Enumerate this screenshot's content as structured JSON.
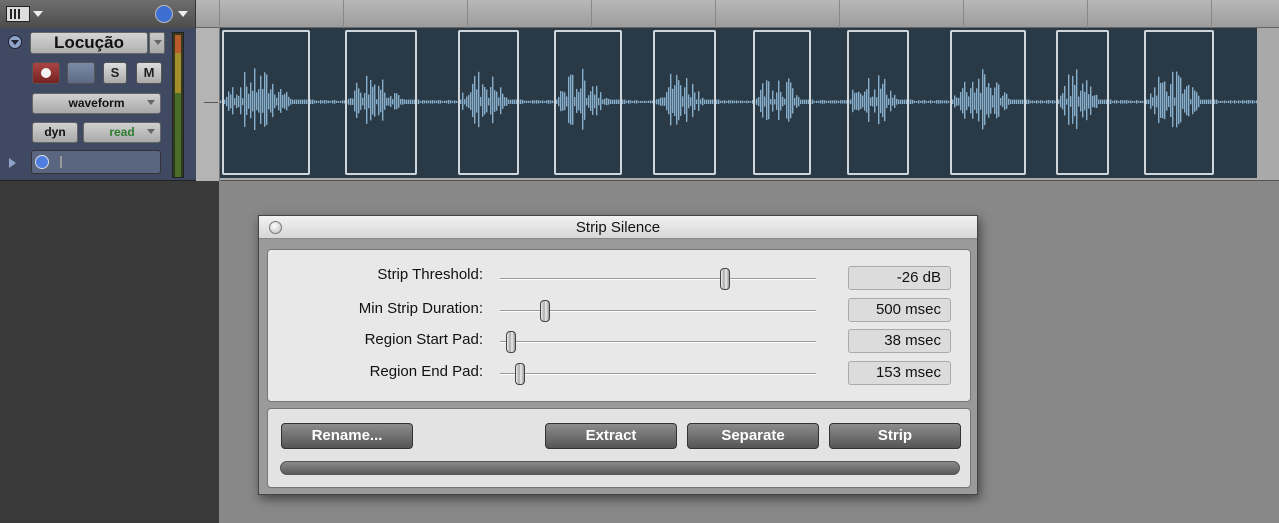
{
  "track": {
    "name": "Locução",
    "view_mode": "waveform",
    "automation_label": "dyn",
    "automation_mode": "read",
    "solo_label": "S",
    "mute_label": "M"
  },
  "dialog": {
    "title": "Strip Silence",
    "params": [
      {
        "label": "Strip Threshold:",
        "value": "-26 dB",
        "level": 0.72
      },
      {
        "label": "Min Strip Duration:",
        "value": "500 msec",
        "level": 0.13
      },
      {
        "label": "Region Start Pad:",
        "value": "38 msec",
        "level": 0.02
      },
      {
        "label": "Region End Pad:",
        "value": "153 msec",
        "level": 0.05
      }
    ],
    "buttons": {
      "rename": "Rename...",
      "extract": "Extract",
      "separate": "Separate",
      "strip": "Strip"
    },
    "progress": 0
  },
  "colors": {
    "waveform": "#87aecb",
    "clip_background": "#2a3946",
    "track_header": "#3f4a62",
    "automation_mode_text": "#2e7d2e"
  }
}
